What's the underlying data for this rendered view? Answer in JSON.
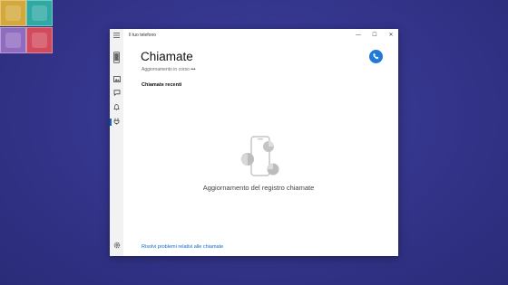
{
  "desktop": {
    "tile_colors": [
      "#d4a83a",
      "#2ea9a4",
      "#8f6cc0",
      "#d24a5d"
    ]
  },
  "window": {
    "title": "Il tuo telefono",
    "controls": {
      "minimize": "—",
      "maximize": "☐",
      "close": "✕"
    }
  },
  "sidebar": {
    "items": [
      {
        "name": "menu-icon"
      },
      {
        "name": "phone-icon"
      },
      {
        "name": "photos-icon"
      },
      {
        "name": "messages-icon"
      },
      {
        "name": "notifications-icon"
      },
      {
        "name": "calls-icon",
        "active": true
      },
      {
        "name": "settings-icon"
      }
    ]
  },
  "main": {
    "title": "Chiamate",
    "status": "Aggiornamento in corso",
    "status_dots": "•••",
    "section_label": "Chiamate recenti",
    "empty_text": "Aggiornamento del registro chiamate",
    "troubleshoot_link": "Risolvi problemi relativi alle chiamate"
  },
  "colors": {
    "accent": "#0f6cbd",
    "fab": "#1f7ad8",
    "background": "#33348a"
  }
}
